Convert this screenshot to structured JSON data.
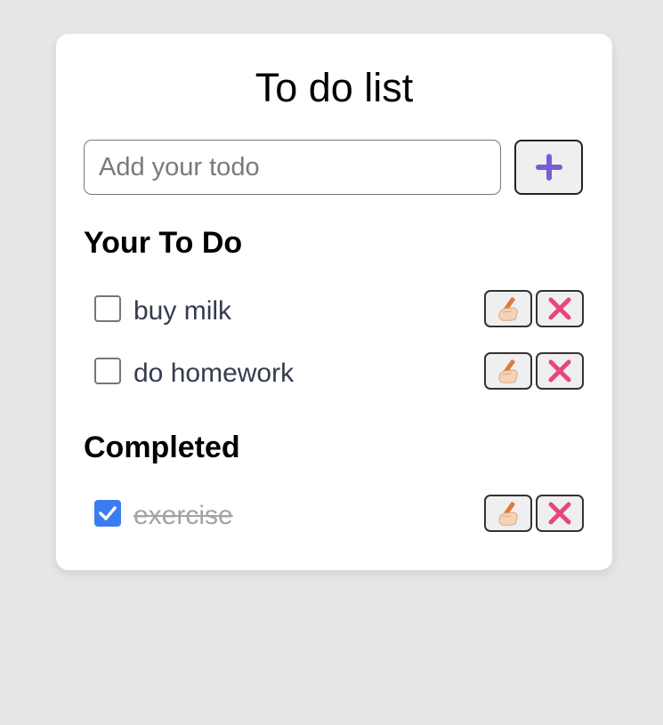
{
  "app": {
    "title": "To do list"
  },
  "input": {
    "placeholder": "Add your todo",
    "value": ""
  },
  "add_button": {
    "icon": "plus-icon"
  },
  "sections": {
    "todo_heading": "Your To Do",
    "completed_heading": "Completed"
  },
  "todos": [
    {
      "text": "buy milk",
      "completed": false
    },
    {
      "text": "do homework",
      "completed": false
    }
  ],
  "completed": [
    {
      "text": "exercise",
      "completed": true
    }
  ],
  "item_actions": {
    "edit_icon": "writing-hand-icon",
    "delete_icon": "cross-mark-icon"
  },
  "colors": {
    "background": "#e6e6e6",
    "card": "#ffffff",
    "checkbox_checked": "#3b7cf2",
    "plus": "#7b5cd6",
    "cross": "#e8467a",
    "completed_text": "#a3a3a3"
  }
}
